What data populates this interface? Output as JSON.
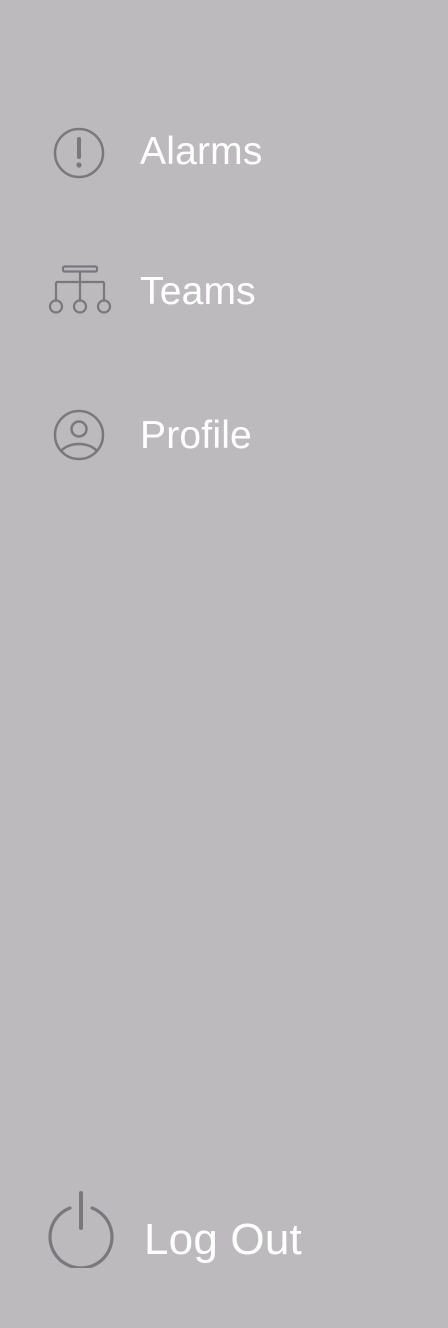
{
  "nav": {
    "items": [
      {
        "label": "Alarms",
        "icon": "alarm-exclamation-icon"
      },
      {
        "label": "Teams",
        "icon": "teams-hierarchy-icon"
      },
      {
        "label": "Profile",
        "icon": "profile-user-icon"
      }
    ]
  },
  "footer": {
    "logout_label": "Log Out",
    "icon": "power-icon"
  },
  "colors": {
    "background": "#bcbabd",
    "text": "#ffffff",
    "icon": "#7a787c"
  }
}
